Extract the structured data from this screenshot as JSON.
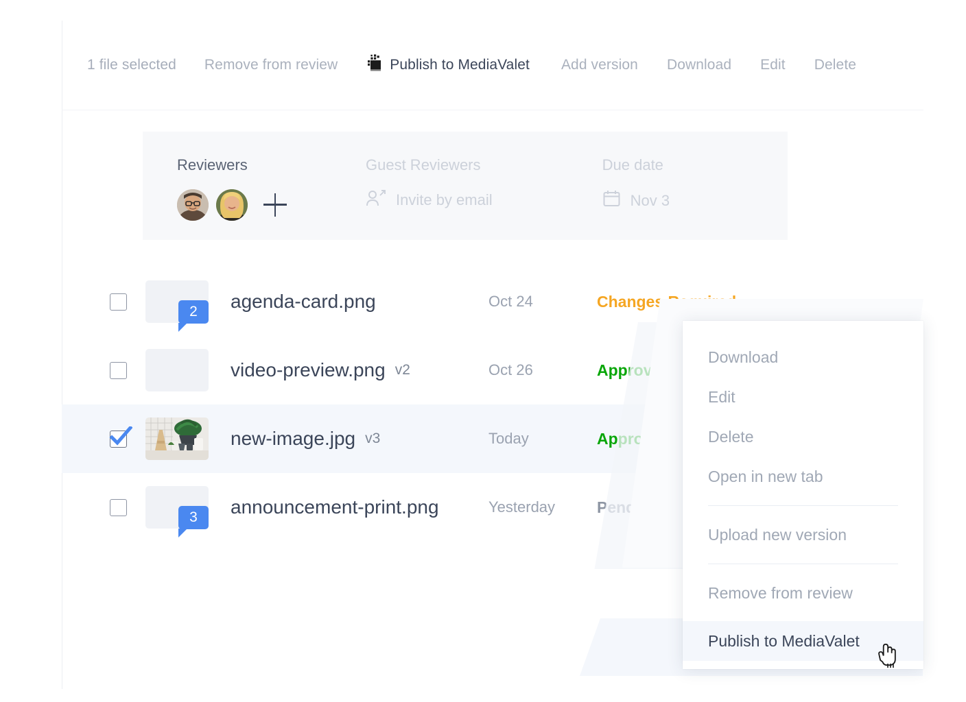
{
  "toolbar": {
    "selection_label": "1 file selected",
    "remove_label": "Remove from review",
    "publish_label": "Publish to MediaValet",
    "publish_icon": "mediavalet-icon",
    "add_version_label": "Add version",
    "download_label": "Download",
    "edit_label": "Edit",
    "delete_label": "Delete"
  },
  "review_bar": {
    "reviewers_label": "Reviewers",
    "add_reviewer_icon": "plus-icon",
    "guest_reviewers_label": "Guest Reviewers",
    "invite_label": "Invite by email",
    "invite_icon": "user-invite-icon",
    "due_date_label": "Due date",
    "due_date_value": "Nov 3",
    "due_date_icon": "calendar-icon",
    "avatars": [
      "reviewer-avatar-1",
      "reviewer-avatar-2"
    ]
  },
  "files": [
    {
      "name": "agenda-card.png",
      "version": "",
      "date": "Oct 24",
      "status": "Changes Required",
      "status_color": "#f5a623",
      "comments": "2",
      "checked": false,
      "has_thumb": false
    },
    {
      "name": "video-preview.png",
      "version": "v2",
      "date": "Oct 26",
      "status": "Approved",
      "status_color": "#09a609",
      "comments": "",
      "checked": false,
      "has_thumb": false
    },
    {
      "name": "new-image.jpg",
      "version": "v3",
      "date": "Today",
      "status": "Approved",
      "status_color": "#09a609",
      "comments": "",
      "checked": true,
      "has_thumb": true
    },
    {
      "name": "announcement-print.png",
      "version": "",
      "date": "Yesterday",
      "status": "Pending Approval",
      "status_color": "#8d95a3",
      "comments": "3",
      "checked": false,
      "has_thumb": false
    }
  ],
  "context_menu": {
    "items": [
      {
        "label": "Download",
        "highlighted": false
      },
      {
        "label": "Edit",
        "highlighted": false
      },
      {
        "label": "Delete",
        "highlighted": false
      },
      {
        "label": "Open in new tab",
        "highlighted": false
      },
      {
        "label": "Upload new version",
        "highlighted": false
      },
      {
        "label": "Remove from review",
        "highlighted": false
      },
      {
        "label": "Publish to MediaValet",
        "highlighted": true
      }
    ],
    "cursor_icon": "pointing-hand-cursor"
  },
  "colors": {
    "accent_blue": "#4a88f0",
    "approved_green": "#09a609",
    "changes_orange": "#f5a623",
    "pending_grey": "#8d95a3",
    "row_highlight": "#f4f7fc",
    "panel_grey": "#f7f8fa"
  }
}
